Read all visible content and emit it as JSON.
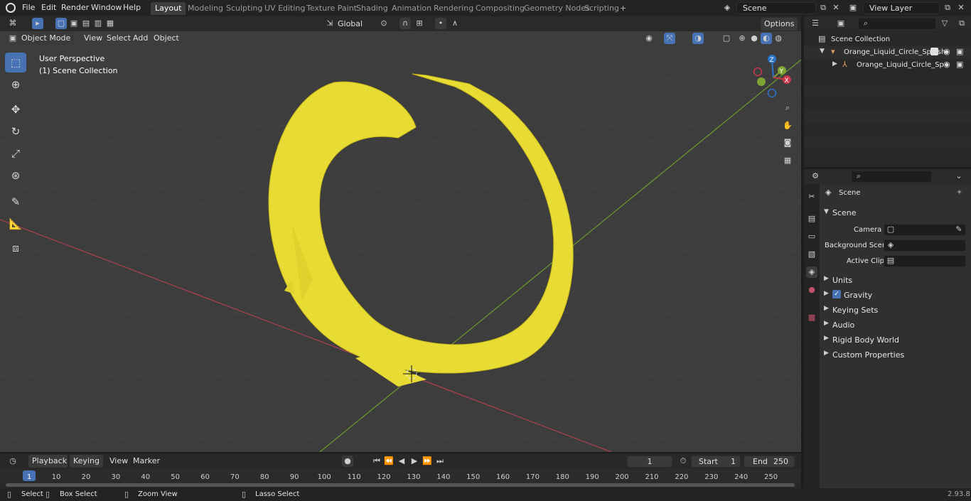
{
  "menubar": {
    "items": [
      "File",
      "Edit",
      "Render",
      "Window",
      "Help"
    ],
    "workspace_tabs": [
      "Layout",
      "Modeling",
      "Sculpting",
      "UV Editing",
      "Texture Paint",
      "Shading",
      "Animation",
      "Rendering",
      "Compositing",
      "Geometry Nodes",
      "Scripting"
    ],
    "active_tab": "Layout",
    "add_tab": "+",
    "scene_name": "Scene",
    "view_layer": "View Layer"
  },
  "viewport_header": {
    "mode": "Object Mode",
    "menus": [
      "View",
      "Select",
      "Add",
      "Object"
    ],
    "orientation": "Global",
    "options": "Options"
  },
  "viewport": {
    "perspective": "User Perspective",
    "collection": "(1) Scene Collection",
    "gizmo_axes": {
      "z": "Z",
      "y": "Y",
      "x": "X"
    },
    "colors": {
      "axis_x": "#c9384a",
      "axis_y": "#7ea434",
      "axis_z": "#2b74c8",
      "liquid": "#e8dc34"
    }
  },
  "outliner": {
    "root": "Scene Collection",
    "items": [
      {
        "name": "Orange_Liquid_Circle_Splash"
      },
      {
        "name": "Orange_Liquid_Circle_Sp"
      }
    ]
  },
  "properties": {
    "context": "Scene",
    "section": "Scene",
    "fields": [
      {
        "label": "Camera"
      },
      {
        "label": "Background Scene"
      },
      {
        "label": "Active Clip"
      }
    ],
    "panels": [
      "Units",
      "Gravity",
      "Keying Sets",
      "Audio",
      "Rigid Body World",
      "Custom Properties"
    ],
    "gravity_checked": true
  },
  "timeline": {
    "menus": [
      "Playback",
      "Keying",
      "View",
      "Marker"
    ],
    "current_frame": "1",
    "start_label": "Start",
    "start": "1",
    "end_label": "End",
    "end": "250",
    "ticks": [
      "1",
      "10",
      "20",
      "30",
      "40",
      "50",
      "60",
      "70",
      "80",
      "90",
      "100",
      "110",
      "120",
      "130",
      "140",
      "150",
      "160",
      "170",
      "180",
      "190",
      "200",
      "210",
      "220",
      "230",
      "240",
      "250"
    ]
  },
  "statusbar": {
    "select": "Select",
    "box_select": "Box Select",
    "zoom_view": "Zoom View",
    "lasso_select": "Lasso Select",
    "version": "2.93.8"
  }
}
